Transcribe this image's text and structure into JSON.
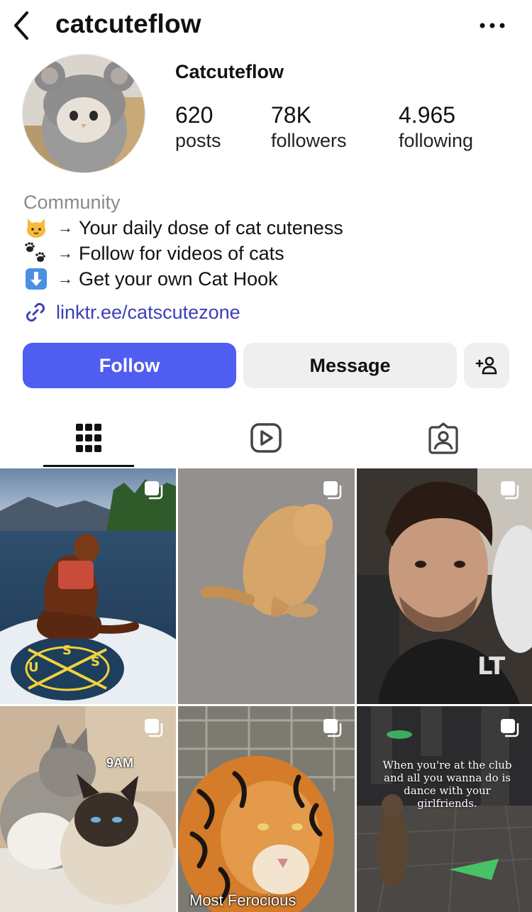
{
  "header": {
    "username": "catcuteflow",
    "back_icon": "chevron-left-icon",
    "more_icon": "ellipsis-icon"
  },
  "profile": {
    "display_name": "Catcuteflow",
    "stats": [
      {
        "value": "620",
        "label": "posts"
      },
      {
        "value": "78K",
        "label": "followers"
      },
      {
        "value": "4.965",
        "label": "following"
      }
    ],
    "category": "Community",
    "bio": [
      {
        "emoji": "cat-face-icon",
        "text": "Your daily dose of cat cuteness"
      },
      {
        "emoji": "paw-prints-icon",
        "text": "Follow for videos of cats"
      },
      {
        "emoji": "down-arrow-button-icon",
        "text": "Get your own Cat Hook"
      }
    ],
    "link": "linktr.ee/catscutezone"
  },
  "actions": {
    "follow_label": "Follow",
    "message_label": "Message",
    "add_user_icon": "add-person-icon"
  },
  "tabs": [
    {
      "name": "posts",
      "icon": "grid-icon",
      "active": true
    },
    {
      "name": "reels",
      "icon": "reels-icon",
      "active": false
    },
    {
      "name": "tagged",
      "icon": "tagged-icon",
      "active": false
    }
  ],
  "grid": {
    "posts": [
      {
        "subject": "cat on paddleboard",
        "overlay": ""
      },
      {
        "subject": "ginger cat lying on floor",
        "overlay": ""
      },
      {
        "subject": "man selfie",
        "overlay": ""
      },
      {
        "subject": "two cats cuddling",
        "overlay": "9AM"
      },
      {
        "subject": "tiger close-up",
        "overlay": "Most Ferocious"
      },
      {
        "subject": "cat dancing in club",
        "overlay": "When you're at the club and all you wanna do is dance with your girlfriends."
      }
    ]
  },
  "colors": {
    "accent": "#4f5df0",
    "link": "#3b3fb8",
    "secondary_button": "#efeff0",
    "muted_text": "#8a8a8a"
  }
}
